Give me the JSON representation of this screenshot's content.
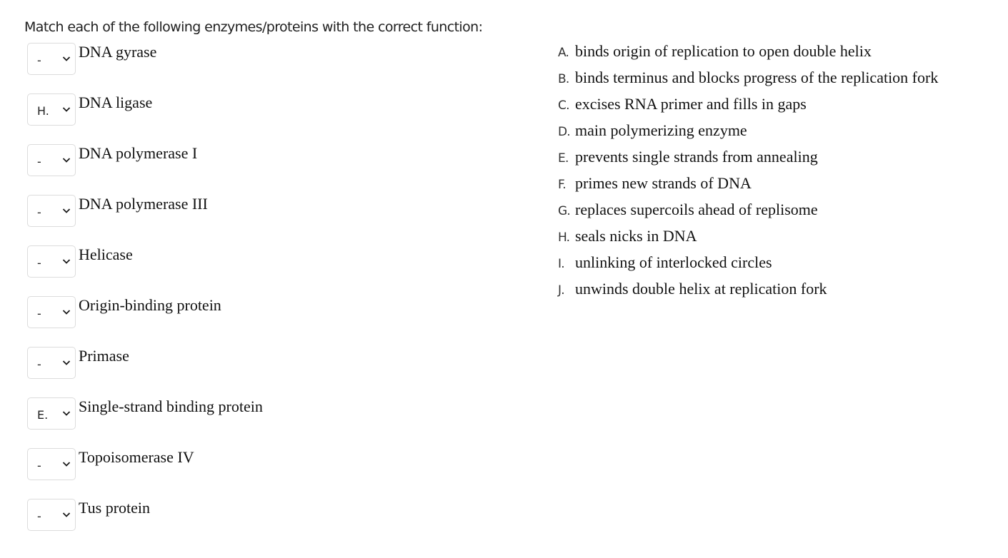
{
  "prompt": "Match each of the following enzymes/proteins with the correct function:",
  "items": [
    {
      "label": "DNA gyrase",
      "selected": "-"
    },
    {
      "label": "DNA ligase",
      "selected": "H."
    },
    {
      "label": "DNA polymerase I",
      "selected": "-"
    },
    {
      "label": "DNA polymerase III",
      "selected": "-"
    },
    {
      "label": "Helicase",
      "selected": "-"
    },
    {
      "label": "Origin-binding protein",
      "selected": "-"
    },
    {
      "label": "Primase",
      "selected": "-"
    },
    {
      "label": "Single-strand binding protein",
      "selected": "E."
    },
    {
      "label": "Topoisomerase IV",
      "selected": "-"
    },
    {
      "label": "Tus protein",
      "selected": "-"
    }
  ],
  "options": [
    {
      "letter": "A.",
      "text": "binds origin of replication to open double helix"
    },
    {
      "letter": "B.",
      "text": "binds terminus and blocks progress of the replication fork"
    },
    {
      "letter": "C.",
      "text": "excises RNA primer and fills in gaps"
    },
    {
      "letter": "D.",
      "text": "main polymerizing enzyme"
    },
    {
      "letter": "E.",
      "text": "prevents single strands from annealing"
    },
    {
      "letter": "F.",
      "text": "primes new strands of DNA"
    },
    {
      "letter": "G.",
      "text": "replaces supercoils ahead of replisome"
    },
    {
      "letter": "H.",
      "text": "seals nicks in DNA"
    },
    {
      "letter": "I.",
      "text": "unlinking of interlocked circles"
    },
    {
      "letter": "J.",
      "text": "unwinds double helix at replication fork"
    }
  ],
  "icons": {
    "dropdown": "chevron-down-icon"
  }
}
